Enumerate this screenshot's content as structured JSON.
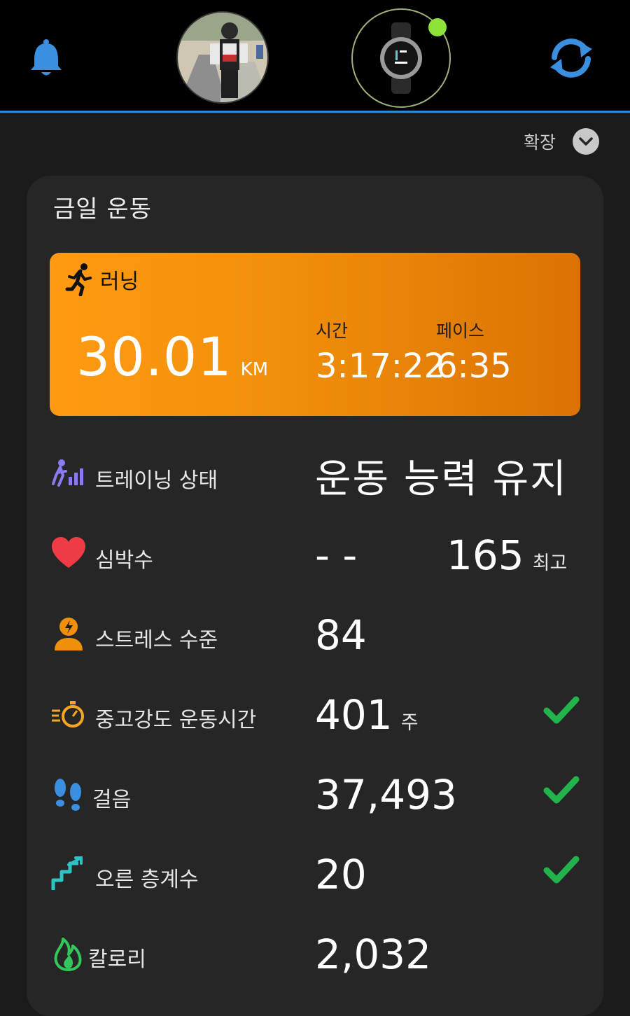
{
  "header": {
    "bell_icon": "bell-icon",
    "avatar_icon": "profile-photo",
    "device_icon": "watch-icon",
    "sync_icon": "sync-icon",
    "accent_color": "#2e8ad8",
    "device_status_color": "#8ee33a"
  },
  "expand": {
    "label": "확장",
    "icon": "chevron-down-icon"
  },
  "card": {
    "title": "금일 운동",
    "activity": {
      "type_label": "러닝",
      "type_icon": "running-icon",
      "distance": "30.01",
      "distance_unit": "KM",
      "time_label": "시간",
      "time_value": "3:17:22",
      "pace_label": "페이스",
      "pace_value": "6:35",
      "color": "#f08f0a"
    },
    "metrics": [
      {
        "label": "트레이닝 상태",
        "value": "운동 능력 유지",
        "icon": "training-status-icon"
      },
      {
        "label": "심박수",
        "value": "- -",
        "value2": "165",
        "value2_unit": "최고",
        "icon": "heart-icon"
      },
      {
        "label": "스트레스 수준",
        "value": "84",
        "icon": "stress-icon"
      },
      {
        "label": "중고강도 운동시간",
        "value": "401",
        "unit": "주",
        "goal_met": true,
        "icon": "intensity-minutes-icon"
      },
      {
        "label": "걸음",
        "value": "37,493",
        "goal_met": true,
        "icon": "footsteps-icon"
      },
      {
        "label": "오른 층계수",
        "value": "20",
        "goal_met": true,
        "icon": "stairs-icon"
      },
      {
        "label": "칼로리",
        "value": "2,032",
        "icon": "flame-icon"
      }
    ]
  }
}
